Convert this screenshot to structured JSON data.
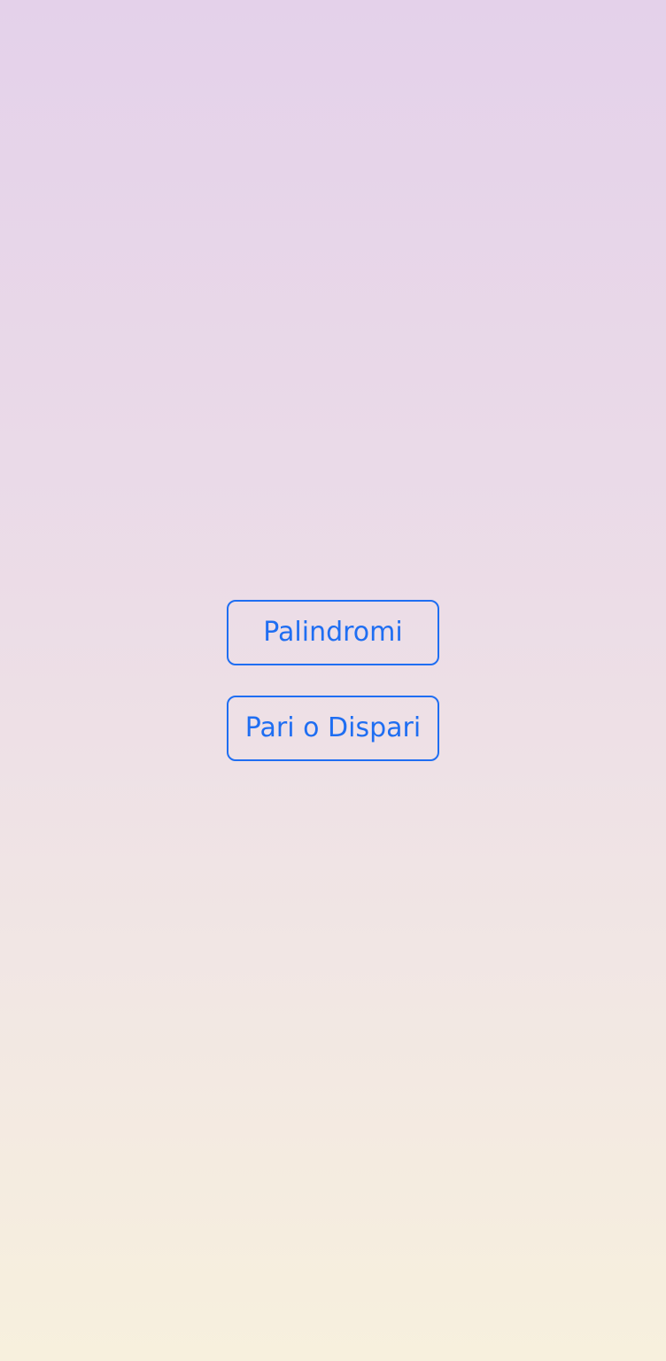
{
  "app": {
    "background_top": "#e4d1ea",
    "background_bottom": "#f7f0dd",
    "accent_color": "#1f6ef2"
  },
  "menu": {
    "buttons": [
      {
        "label": "Palindromi"
      },
      {
        "label": "Pari o Dispari"
      }
    ]
  }
}
